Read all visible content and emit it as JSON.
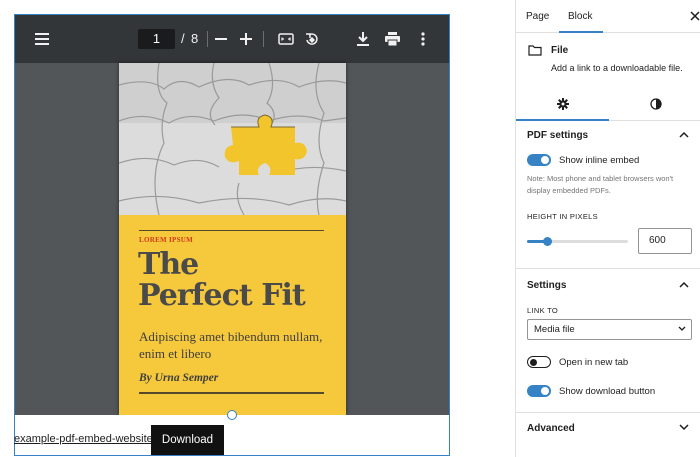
{
  "viewer": {
    "current_page": "1",
    "separator": "/",
    "total_pages": "8",
    "icons": [
      "menu-icon",
      "zoom-out-icon",
      "zoom-in-icon",
      "fit-page-icon",
      "rotate-icon",
      "download-icon",
      "print-icon",
      "more-options-icon"
    ]
  },
  "pdf_cover": {
    "eyebrow": "LOREM IPSUM",
    "title_line1": "The",
    "title_line2": "Perfect Fit",
    "subtitle": "Adipiscing amet bibendum nullam, enim et libero",
    "author": "By Urna Semper"
  },
  "file_block": {
    "link_text": "example-pdf-embed-website",
    "button_label": "Download"
  },
  "sidebar": {
    "tabs": [
      {
        "label": "Page",
        "active": false
      },
      {
        "label": "Block",
        "active": true
      }
    ],
    "block_name": "File",
    "block_description": "Add a link to a downloadable file.",
    "style_tabs": [
      {
        "icon": "gear-icon",
        "active": true
      },
      {
        "icon": "contrast-icon",
        "active": false
      }
    ],
    "pdf_settings": {
      "title": "PDF settings",
      "show_inline_embed": {
        "label": "Show inline embed",
        "checked": true
      },
      "note": "Note: Most phone and tablet browsers won't display embedded PDFs.",
      "height_label": "HEIGHT IN PIXELS",
      "height_value": "600",
      "slider_fraction": 0.2
    },
    "settings": {
      "title": "Settings",
      "link_to_label": "LINK TO",
      "link_to_value": "Media file",
      "open_new_tab": {
        "label": "Open in new tab",
        "checked": false
      },
      "show_download_button": {
        "label": "Show download button",
        "checked": true
      }
    },
    "advanced": {
      "title": "Advanced"
    }
  },
  "colors": {
    "accent": "#3582c4",
    "viewer_background": "#525659",
    "viewer_toolbar": "#323639",
    "cover_yellow": "#f6c83b",
    "eyebrow_red": "#d13b1b"
  }
}
